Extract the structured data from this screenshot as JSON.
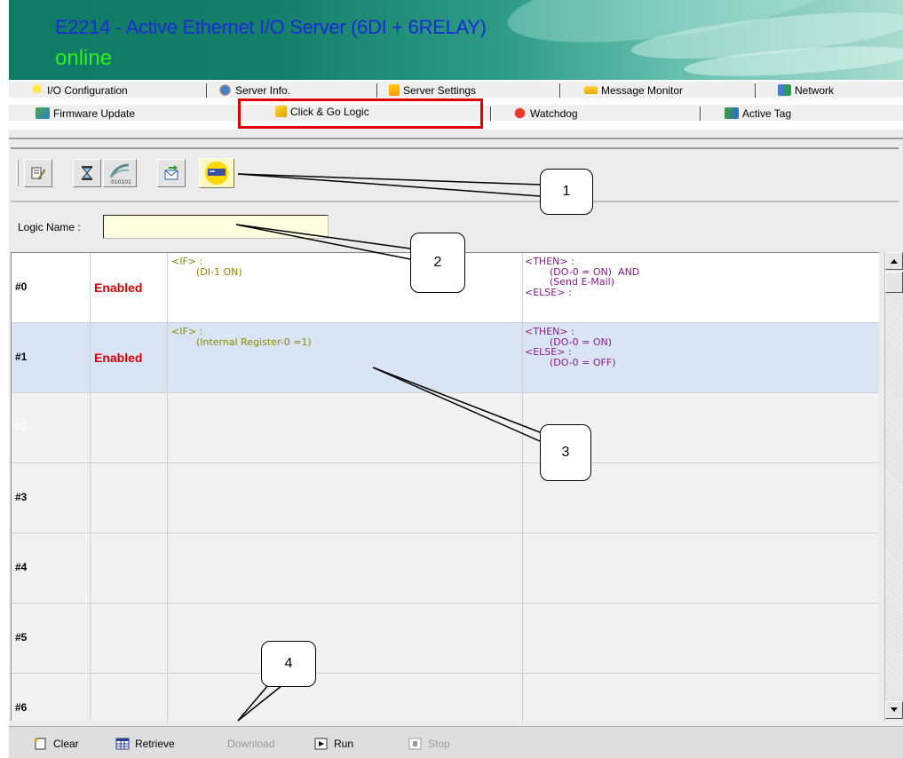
{
  "header": {
    "title": "E2214 - Active Ethernet I/O Server (6DI + 6RELAY)",
    "status": "online"
  },
  "tabs_row1": [
    {
      "label": "I/O Configuration",
      "icon": "lightbulb-icon"
    },
    {
      "label": "Server Info.",
      "icon": "info-icon"
    },
    {
      "label": "Server Settings",
      "icon": "settings-icon"
    },
    {
      "label": "Message Monitor",
      "icon": "message-icon"
    },
    {
      "label": "Network",
      "icon": "network-icon"
    }
  ],
  "tabs_row2": [
    {
      "label": "Firmware Update",
      "icon": "firmware-icon"
    },
    {
      "label": "Click & Go Logic",
      "icon": "logic-icon",
      "selected": true
    },
    {
      "label": "Watchdog",
      "icon": "watchdog-icon"
    },
    {
      "label": "Active Tag",
      "icon": "active-tag-icon"
    }
  ],
  "toolbar": {
    "buttons": [
      "edit-icon",
      "timer-icon",
      "pulse-icon",
      "email-icon",
      "server-icon"
    ]
  },
  "logic_name": {
    "label": "Logic Name :",
    "value": ""
  },
  "rules": [
    {
      "id": "#0",
      "status": "Enabled",
      "condition": "<IF> :\n        (DI-1 ON)",
      "action": "<THEN> :\n        (DO-0 = ON)  AND\n        (Send E-Mail)\n<ELSE> :",
      "highlight": false
    },
    {
      "id": "#1",
      "status": "Enabled",
      "condition": "<IF> :\n        (Internal Register-0 =1)",
      "action": "<THEN> :\n        (DO-0 = ON)\n<ELSE> :\n        (DO-0 = OFF)",
      "highlight": true
    },
    {
      "id": "#2",
      "status": "",
      "condition": "",
      "action": "",
      "highlight": false,
      "dim": true
    },
    {
      "id": "#3",
      "status": "",
      "condition": "",
      "action": "",
      "highlight": false
    },
    {
      "id": "#4",
      "status": "",
      "condition": "",
      "action": "",
      "highlight": false
    },
    {
      "id": "#5",
      "status": "",
      "condition": "",
      "action": "",
      "highlight": false
    },
    {
      "id": "#6",
      "status": "",
      "condition": "",
      "action": "",
      "highlight": false
    }
  ],
  "bottom_buttons": [
    {
      "label": "Clear",
      "icon": "clear-icon",
      "enabled": true
    },
    {
      "label": "Retrieve",
      "icon": "retrieve-icon",
      "enabled": true
    },
    {
      "label": "Download",
      "icon": "download-icon",
      "enabled": false
    },
    {
      "label": "Run",
      "icon": "run-icon",
      "enabled": true
    },
    {
      "label": "Stop",
      "icon": "stop-icon",
      "enabled": false
    }
  ],
  "callouts": [
    "1",
    "2",
    "3",
    "4"
  ],
  "colors": {
    "title": "#1a2ad6",
    "status": "#2cf01b",
    "enabled": "#e00000",
    "condition": "#8a8a00",
    "action": "#8b1b8b",
    "row_highlight": "#d9e4f5",
    "selection_box": "#e00000"
  }
}
